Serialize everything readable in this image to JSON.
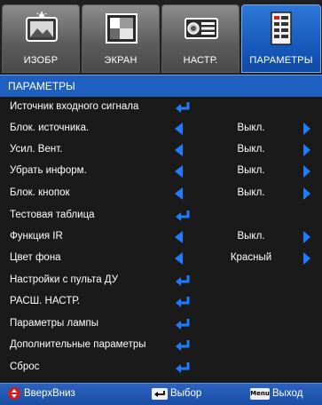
{
  "tabs": [
    {
      "label": "ИЗОБР",
      "icon": "picture-icon",
      "active": false
    },
    {
      "label": "ЭКРАН",
      "icon": "screen-icon",
      "active": false
    },
    {
      "label": "НАСТР.",
      "icon": "projector-icon",
      "active": false
    },
    {
      "label": "ПАРАМЕТРЫ",
      "icon": "options-icon",
      "active": true
    }
  ],
  "header": {
    "title": "ПАРАМЕТРЫ"
  },
  "rows": [
    {
      "label": "Источник входного сигнала",
      "control": "enter"
    },
    {
      "label": "Блок. источника.",
      "control": "select",
      "value": "Выкл."
    },
    {
      "label": "Усил. Вент.",
      "control": "select",
      "value": "Выкл."
    },
    {
      "label": "Убрать информ.",
      "control": "select",
      "value": "Выкл."
    },
    {
      "label": "Блок. кнопок",
      "control": "select",
      "value": "Выкл."
    },
    {
      "label": "Тестовая таблица",
      "control": "enter"
    },
    {
      "label": "Функция IR",
      "control": "select",
      "value": "Выкл."
    },
    {
      "label": "Цвет фона",
      "control": "select",
      "value": "Красный"
    },
    {
      "label": "Настройки с пульта ДУ",
      "control": "enter"
    },
    {
      "label": "РАСШ. НАСТР.",
      "control": "enter"
    },
    {
      "label": "Параметры лампы",
      "control": "enter"
    },
    {
      "label": "Дополнительные параметры",
      "control": "enter"
    },
    {
      "label": "Сброс",
      "control": "enter"
    }
  ],
  "footer": {
    "nav_label": "ВверхВниз",
    "select_label": "Выбор",
    "menu_key": "Menu",
    "exit_label": "Выход"
  },
  "colors": {
    "accent": "#1f5fbf",
    "arrow": "#1e7cff",
    "background": "#1a1a1a"
  }
}
